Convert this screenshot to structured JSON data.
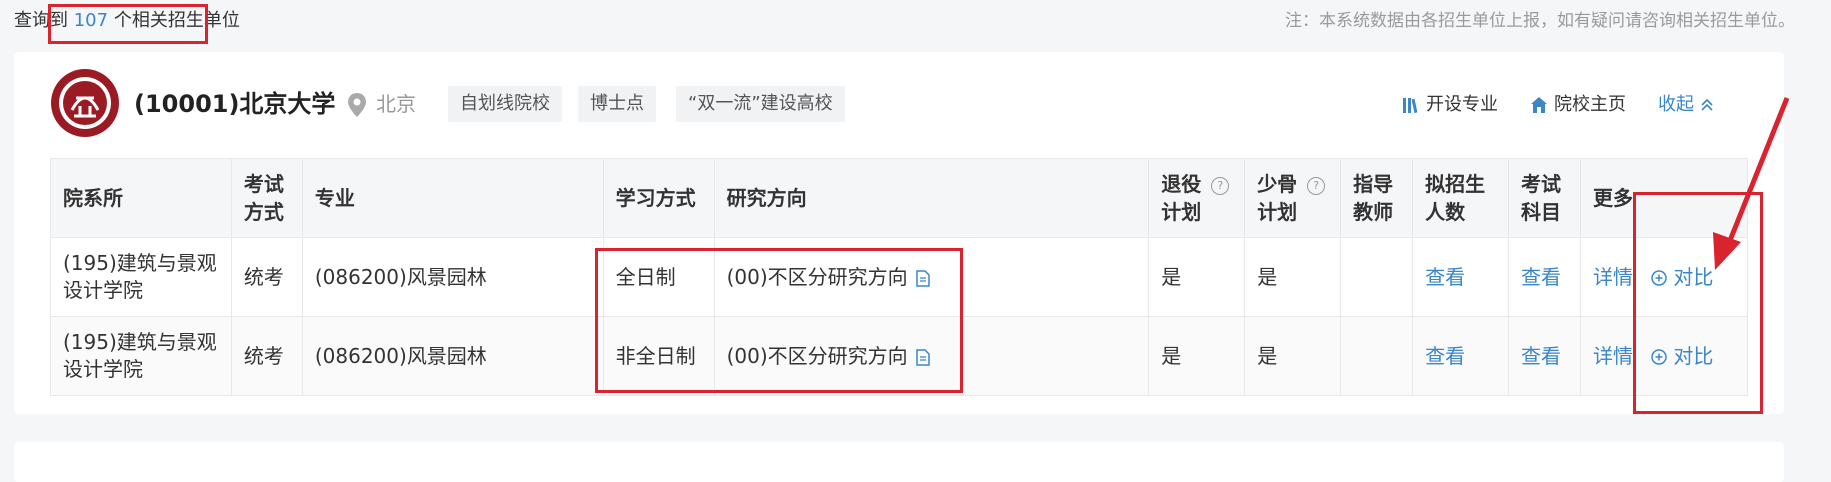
{
  "summary": {
    "prefix": "查询到",
    "count": "107",
    "suffix": "个相关招生单位",
    "note": "注：本系统数据由各招生单位上报，如有疑问请咨询相关招生单位。"
  },
  "university": {
    "name": "(10001)北京大学",
    "location": "北京",
    "tags": [
      "自划线院校",
      "博士点",
      "“双一流”建设高校"
    ],
    "links": {
      "majors": "开设专业",
      "homepage": "院校主页",
      "collapse": "收起"
    }
  },
  "table": {
    "headers": {
      "department": "院系所",
      "exam_line1": "考试",
      "exam_line2": "方式",
      "major": "专业",
      "study_mode": "学习方式",
      "direction": "研究方向",
      "retire_line1": "退役",
      "retire_line2": "计划",
      "minority_line1": "少骨",
      "minority_line2": "计划",
      "advisor_line1": "指导",
      "advisor_line2": "教师",
      "plan_line1": "拟招生",
      "plan_line2": "人数",
      "subjects_line1": "考试",
      "subjects_line2": "科目",
      "more": "更多"
    },
    "rows": [
      {
        "dept_line1": "(195)建筑与景观",
        "dept_line2": "设计学院",
        "exam": "统考",
        "major": "(086200)风景园林",
        "mode": "全日制",
        "direction": "(00)不区分研究方向",
        "retire": "是",
        "minority": "是",
        "advisor": "",
        "plan": "查看",
        "subjects": "查看",
        "detail": "详情",
        "compare": "对比"
      },
      {
        "dept_line1": "(195)建筑与景观",
        "dept_line2": "设计学院",
        "exam": "统考",
        "major": "(086200)风景园林",
        "mode": "非全日制",
        "direction": "(00)不区分研究方向",
        "retire": "是",
        "minority": "是",
        "advisor": "",
        "plan": "查看",
        "subjects": "查看",
        "detail": "详情",
        "compare": "对比"
      }
    ]
  },
  "colors": {
    "accent": "#3a86c8",
    "highlight": "#d9232e",
    "logo": "#9b1b24"
  },
  "icons": [
    "peking-university-logo",
    "location-pin-icon",
    "bookshelf-icon",
    "house-icon",
    "chevron-up-icon",
    "help-icon",
    "document-icon",
    "plus-circle-icon",
    "red-arrow"
  ]
}
